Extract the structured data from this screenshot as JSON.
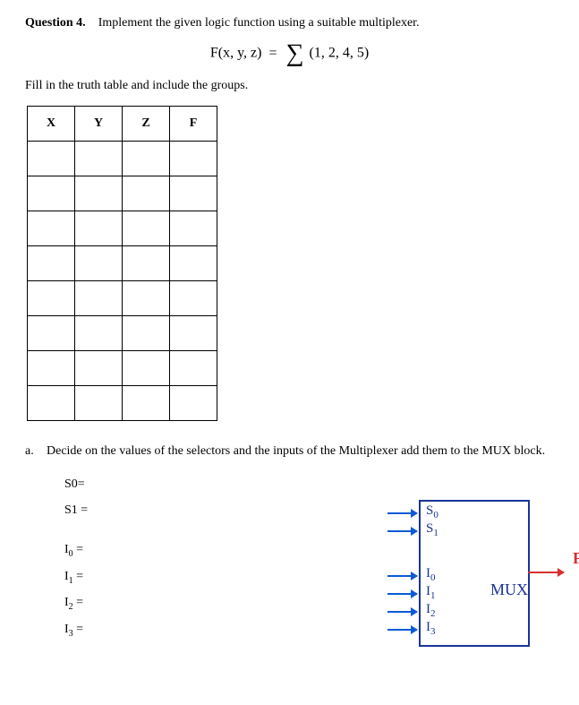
{
  "question": {
    "label": "Question 4.",
    "prompt": "Implement the given logic function using a suitable multiplexer."
  },
  "formula": {
    "lhs": "F(x, y, z)",
    "eq": "=",
    "sigma": "∑",
    "args": "(1, 2, 4, 5)"
  },
  "instruction": "Fill in the truth table and include the groups.",
  "truth_table": {
    "headers": [
      "X",
      "Y",
      "Z",
      "F"
    ],
    "rows": [
      [
        "",
        "",
        "",
        ""
      ],
      [
        "",
        "",
        "",
        ""
      ],
      [
        "",
        "",
        "",
        ""
      ],
      [
        "",
        "",
        "",
        ""
      ],
      [
        "",
        "",
        "",
        ""
      ],
      [
        "",
        "",
        "",
        ""
      ],
      [
        "",
        "",
        "",
        ""
      ],
      [
        "",
        "",
        "",
        ""
      ]
    ]
  },
  "part_a": {
    "label": "a.",
    "text": "Decide on the values of the selectors and the inputs of the Multiplexer add them to the MUX block."
  },
  "answers": {
    "s0_label": "S0=",
    "s1_label": "S1 =",
    "i0_label": "I",
    "i0_sub": "0",
    "i0_eq": " =",
    "i1_label": "I",
    "i1_sub": "1",
    "i1_eq": " =",
    "i2_label": "I",
    "i2_sub": "2",
    "i2_eq": " =",
    "i3_label": "I",
    "i3_sub": "3",
    "i3_eq": " ="
  },
  "mux": {
    "name": "MUX",
    "pins": {
      "s0": "S",
      "s0_sub": "0",
      "s1": "S",
      "s1_sub": "1",
      "i0": "I",
      "i0_sub": "0",
      "i1": "I",
      "i1_sub": "1",
      "i2": "I",
      "i2_sub": "2",
      "i3": "I",
      "i3_sub": "3"
    },
    "output": "F"
  }
}
